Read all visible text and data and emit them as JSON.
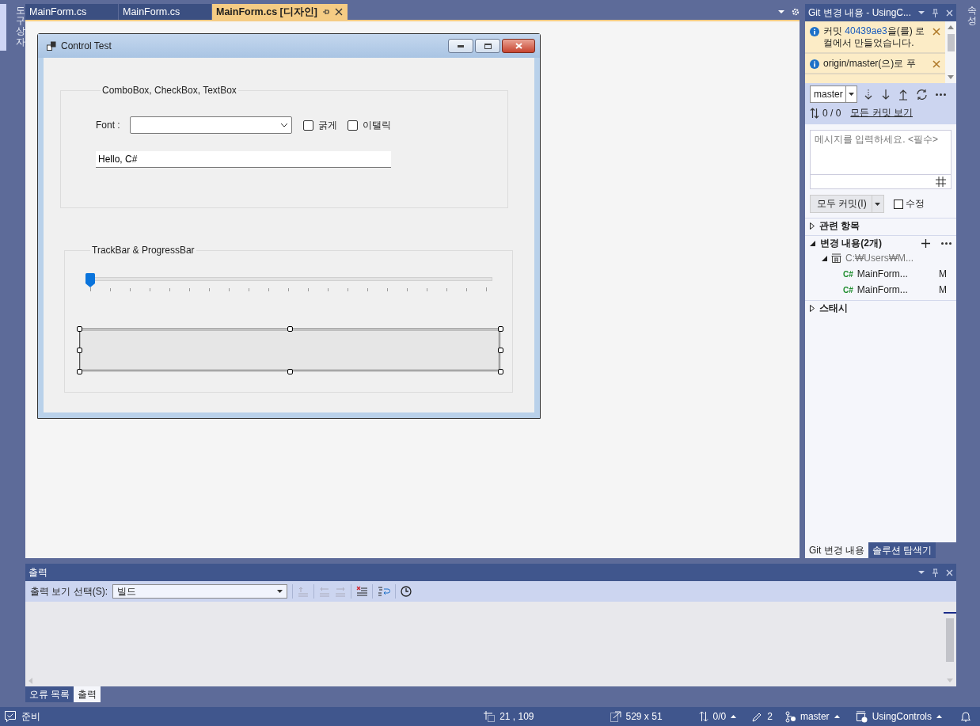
{
  "toolbox_strip": {
    "label": "도구 상자",
    "selected": true
  },
  "properties_strip": {
    "label": "속성"
  },
  "editor_tabs": [
    {
      "label": "MainForm.cs",
      "selected": false
    },
    {
      "label": "MainForm.cs",
      "selected": false
    },
    {
      "label": "MainForm.cs [디자인]",
      "selected": true
    }
  ],
  "form": {
    "title": "Control Test",
    "group_1": {
      "title": "ComboBox, CheckBox, TextBox",
      "font_label": "Font :",
      "checkboxes": [
        {
          "label": "굵게",
          "checked": false
        },
        {
          "label": "이탤릭",
          "checked": false
        }
      ],
      "textbox": {
        "value": "Hello, C#"
      }
    },
    "group_2": {
      "title": "TrackBar & ProgressBar",
      "trackbar": {
        "level": 0
      },
      "progressbar": {
        "level": 0,
        "selected": true
      }
    }
  },
  "git_panel": {
    "title": "Git 변경 내용 - UsingC...",
    "notifications": [
      {
        "prefix": "커밋 ",
        "link": "40439ae3",
        "suffix": "을(를) 로컬에서 만들었습니다."
      },
      {
        "prefix": "origin/master(으)로 푸"
      }
    ],
    "branch": "master",
    "counts": "0 / 0",
    "all_commits_link": "모든 커밋 보기",
    "message": {
      "placeholder": "메시지를 입력하세요. <필수>"
    },
    "commit_button": "모두 커밋(I)",
    "amend": {
      "label": "수정",
      "checked": false
    },
    "sections": [
      {
        "title": "관련 항목",
        "expanded": false
      },
      {
        "title": "변경 내용(2개)",
        "expanded": true,
        "children": [
          {
            "label": "C:₩Users₩M...",
            "expanded": true,
            "children": [
              {
                "lang": "C#",
                "label": "MainForm...",
                "status": "M"
              },
              {
                "lang": "C#",
                "label": "MainForm...",
                "status": "M"
              }
            ]
          }
        ]
      },
      {
        "title": "스태시",
        "expanded": false
      }
    ],
    "tabs": [
      {
        "label": "Git 변경 내용",
        "selected": true
      },
      {
        "label": "솔루션 탐색기",
        "selected": false
      }
    ]
  },
  "output_panel": {
    "title": "출력",
    "source_label": "출력 보기 선택(S):",
    "source": "빌드",
    "tabs": [
      {
        "label": "오류 목록",
        "selected": false
      },
      {
        "label": "출력",
        "selected": true
      }
    ]
  },
  "status_bar": {
    "status": "준비",
    "position": "21 , 109",
    "size": "529 x 51",
    "sync": "0/0",
    "edits": "2",
    "branch": "master",
    "repository": "UsingControls"
  }
}
